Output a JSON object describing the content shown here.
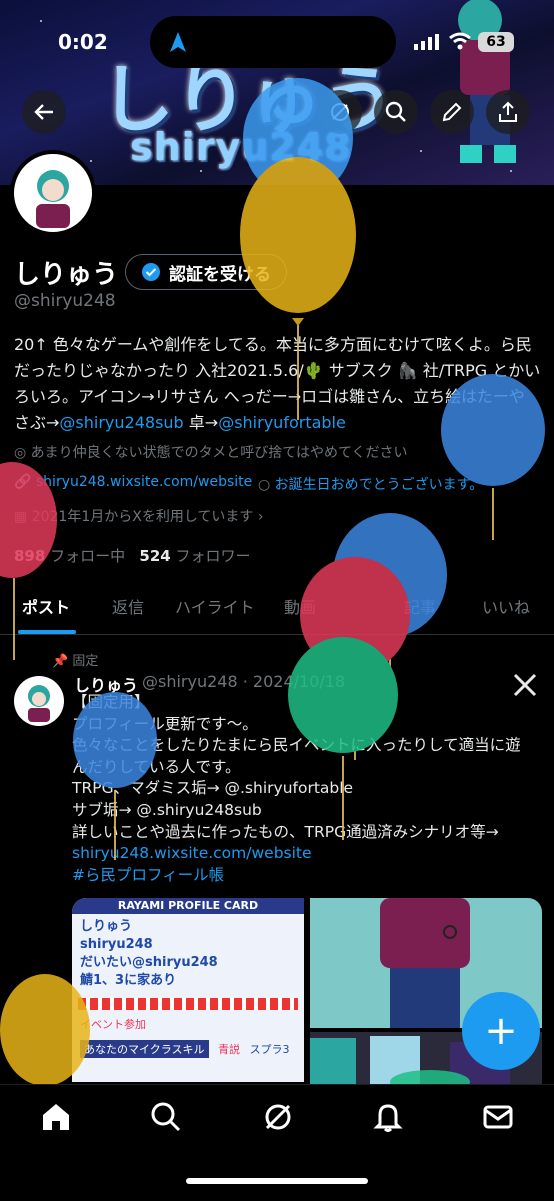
{
  "status_bar": {
    "time": "0:02",
    "battery": "63"
  },
  "banner": {
    "logo_main": "しりゅう",
    "logo_sub": "shiryu248"
  },
  "profile": {
    "name": "しりゅう",
    "verify_label": "認証を受ける",
    "handle": "@shiryu248",
    "bio_line1": "20↑ 色々なゲームや創作をしてる。本当に多方面にむけて呟くよ。ら民",
    "bio_line2": "だったりじゃなかったり 入社2021.5.6/🌵 サブスク 🦍 社/TRPG とかい",
    "bio_line3": "ろいろ。アイコン→リサさん へっだー→ロゴは雛さん、立ち絵はたーや",
    "bio_line4_a": "さぶ→",
    "bio_link_sub": "@shiryu248sub",
    "bio_line4_b": " 卓→",
    "bio_link_fortable": "@shiryufortable",
    "location": "あまり仲良くない状態でのタメと呼び捨てはやめてください",
    "website": "shiryu248.wixsite.com/website",
    "birthday": "お誕生日おめでとうございます。",
    "joined": "2021年1月からXを利用しています",
    "following_count": "898",
    "following_label": "フォロー中",
    "followers_count": "524",
    "followers_label": "フォロワー"
  },
  "tabs": [
    "ポスト",
    "返信",
    "ハイライト",
    "動画",
    "記事",
    "いいね"
  ],
  "post": {
    "pinned_label": "固定",
    "author": "しりゅう",
    "handle_date": "@shiryu248 · 2024/10/18",
    "line1": "【固定用】",
    "line2": "プロフィール更新です〜。",
    "line3": "色々なことをしたりたまにら民イベントに入ったりして適当に遊",
    "line4": "んだりしている人です。",
    "line5": "TRPG、マダミス垢→ @.shiryufortable",
    "line6": "サブ垢→ @.shiryu248sub",
    "line7": "詳しいことや過去に作ったもの、TRPG通過済みシナリオ等→",
    "link": "shiryu248.wixsite.com/website",
    "hashtag": "#ら民プロフィール帳"
  },
  "card": {
    "title": "RAYAMI PROFILE CARD",
    "name": "しりゅう",
    "mcid": "shiryu248",
    "address": "だいたい@shiryu248",
    "join": "鯖1、3に家あり",
    "join_text": "イベント参加",
    "skill": "あなたのマイクラスキル",
    "fav1": "青説",
    "fav2": "スプラ3"
  },
  "colors": {
    "accent": "#1d9bf0",
    "background": "#000000",
    "muted": "#71767b"
  },
  "icons": [
    "back-arrow-icon",
    "search-icon",
    "edit-icon",
    "share-icon",
    "verified-icon",
    "location-icon",
    "link-icon",
    "balloon-icon",
    "calendar-icon",
    "pin-icon",
    "x-logo-icon",
    "plus-icon",
    "home-icon",
    "grok-icon",
    "bell-icon",
    "mail-icon"
  ]
}
